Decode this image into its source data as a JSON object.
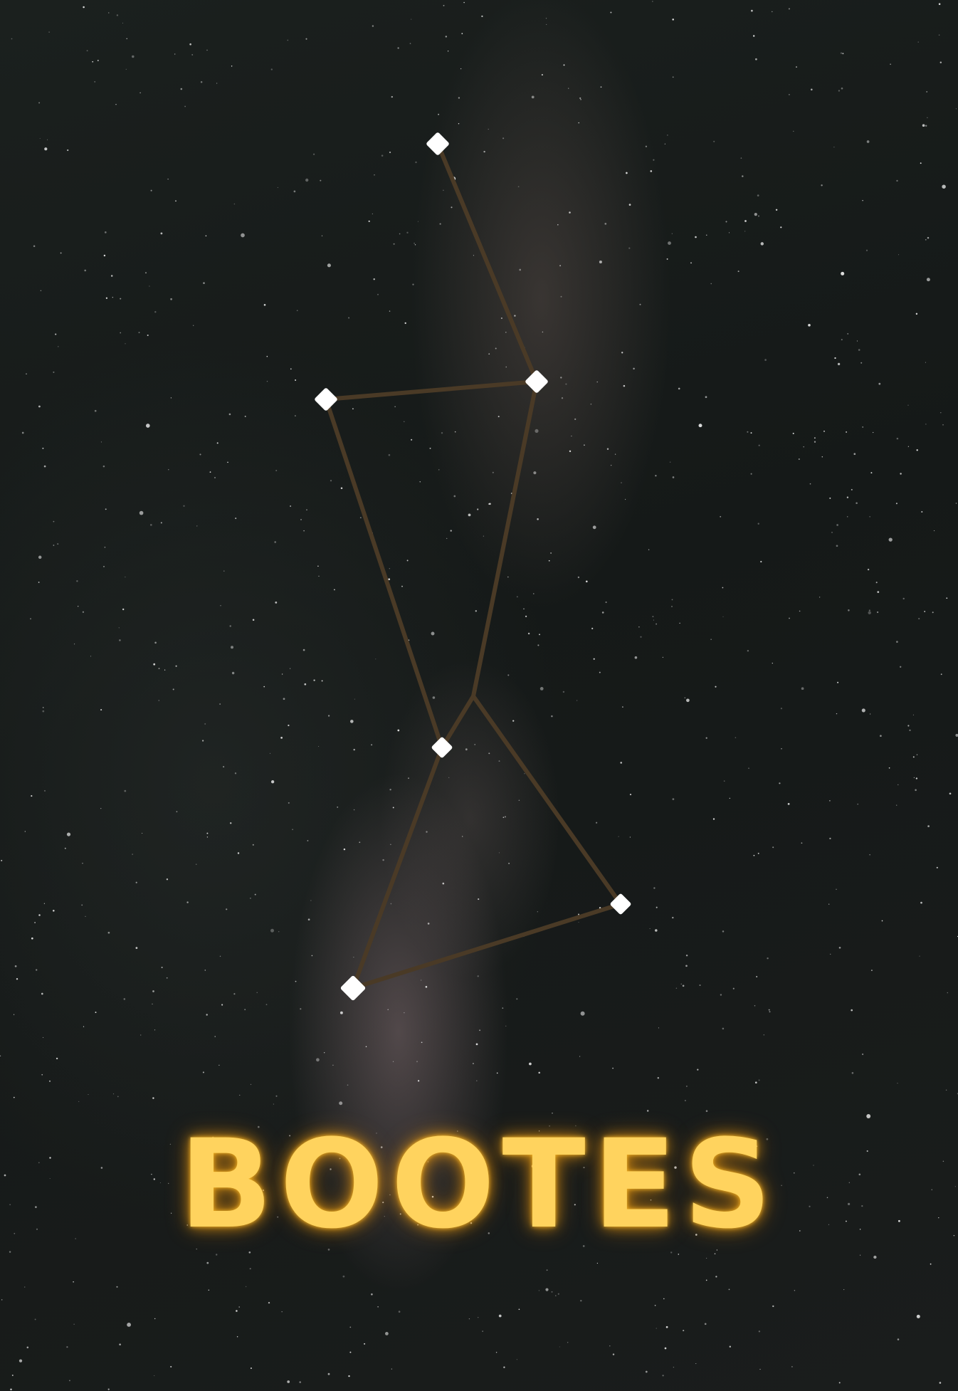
{
  "constellation": {
    "name": "BOOTES",
    "line_color": "#4a3a26",
    "star_color": "#ffffff",
    "title_color": "#ffd35e"
  }
}
